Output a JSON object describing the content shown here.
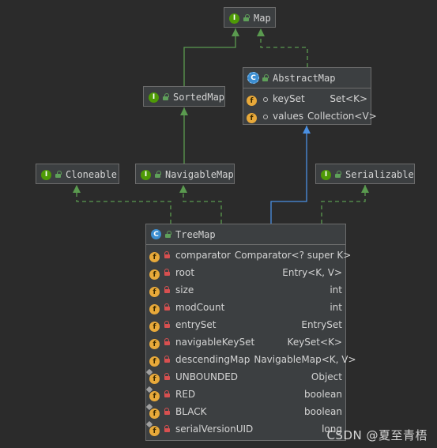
{
  "nodes": {
    "map": {
      "kind": "interface",
      "badge": "I",
      "name": "Map",
      "rows": []
    },
    "sortedmap": {
      "kind": "interface",
      "badge": "I",
      "name": "SortedMap",
      "rows": []
    },
    "abstractmap": {
      "kind": "abstract-class",
      "badge": "C",
      "name": "AbstractMap",
      "rows": [
        {
          "badge": "f",
          "access": "package",
          "name": "keySet",
          "type": "Set<K>"
        },
        {
          "badge": "f",
          "access": "package",
          "name": "values",
          "type": "Collection<V>"
        }
      ]
    },
    "cloneable": {
      "kind": "interface",
      "badge": "I",
      "name": "Cloneable",
      "rows": []
    },
    "navigablemap": {
      "kind": "interface",
      "badge": "I",
      "name": "NavigableMap",
      "rows": []
    },
    "serializable": {
      "kind": "interface",
      "badge": "I",
      "name": "Serializable",
      "rows": []
    },
    "treemap": {
      "kind": "class",
      "badge": "C",
      "name": "TreeMap",
      "rows": [
        {
          "badge": "f",
          "access": "private",
          "static": false,
          "name": "comparator",
          "type": "Comparator<? super K>"
        },
        {
          "badge": "f",
          "access": "private",
          "static": false,
          "name": "root",
          "type": "Entry<K, V>"
        },
        {
          "badge": "f",
          "access": "private",
          "static": false,
          "name": "size",
          "type": "int"
        },
        {
          "badge": "f",
          "access": "private",
          "static": false,
          "name": "modCount",
          "type": "int"
        },
        {
          "badge": "f",
          "access": "private",
          "static": false,
          "name": "entrySet",
          "type": "EntrySet"
        },
        {
          "badge": "f",
          "access": "private",
          "static": false,
          "name": "navigableKeySet",
          "type": "KeySet<K>"
        },
        {
          "badge": "f",
          "access": "private",
          "static": false,
          "name": "descendingMap",
          "type": "NavigableMap<K, V>"
        },
        {
          "badge": "f",
          "access": "private",
          "static": true,
          "name": "UNBOUNDED",
          "type": "Object"
        },
        {
          "badge": "f",
          "access": "private",
          "static": true,
          "name": "RED",
          "type": "boolean"
        },
        {
          "badge": "f",
          "access": "private",
          "static": true,
          "name": "BLACK",
          "type": "boolean"
        },
        {
          "badge": "f",
          "access": "private",
          "static": true,
          "name": "serialVersionUID",
          "type": "long"
        }
      ]
    }
  },
  "edges": [
    {
      "from": "sortedmap",
      "to": "map",
      "kind": "extends"
    },
    {
      "from": "abstractmap",
      "to": "map",
      "kind": "implements"
    },
    {
      "from": "navigablemap",
      "to": "sortedmap",
      "kind": "extends"
    },
    {
      "from": "treemap",
      "to": "abstractmap",
      "kind": "extends-class"
    },
    {
      "from": "treemap",
      "to": "cloneable",
      "kind": "implements"
    },
    {
      "from": "treemap",
      "to": "navigablemap",
      "kind": "implements"
    },
    {
      "from": "treemap",
      "to": "serializable",
      "kind": "implements"
    }
  ],
  "colors": {
    "background": "#2b2b2b",
    "node_fill": "#3c3f41",
    "node_border": "#6c6c6c",
    "interface_edge": "#5a9a4f",
    "class_edge": "#4a90e2",
    "interface_badge": "#4e9a06",
    "class_badge": "#3c8ed1",
    "field_badge": "#e8a93a"
  },
  "watermark": "CSDN @夏至青梧"
}
